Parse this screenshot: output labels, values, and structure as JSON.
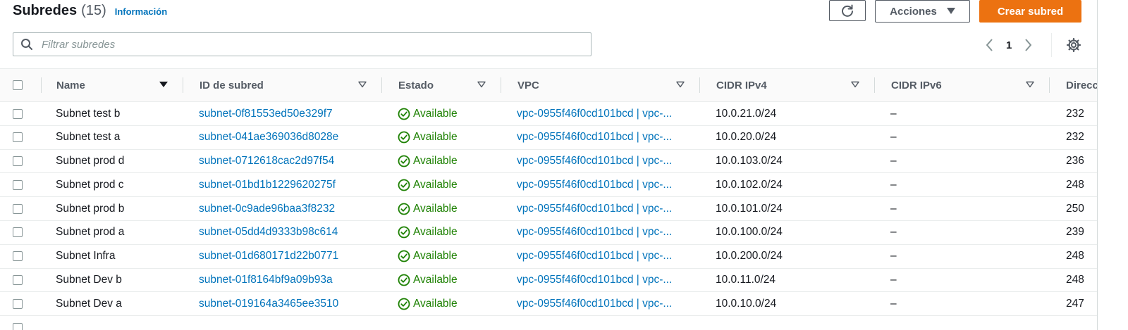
{
  "header": {
    "title": "Subredes",
    "count": "(15)",
    "info_link": "Información"
  },
  "toolbar": {
    "actions_label": "Acciones",
    "create_label": "Crear subred"
  },
  "search": {
    "placeholder": "Filtrar subredes",
    "value": ""
  },
  "pagination": {
    "current_page": "1"
  },
  "table": {
    "columns": {
      "name": "Name",
      "subnet_id": "ID de subred",
      "state": "Estado",
      "vpc": "VPC",
      "cidr_ipv4": "CIDR IPv4",
      "cidr_ipv6": "CIDR IPv6",
      "addresses": "Direcc"
    },
    "rows": [
      {
        "name": "Subnet test b",
        "subnet_id": "subnet-0f81553ed50e329f7",
        "state": "Available",
        "vpc": "vpc-0955f46f0cd101bcd | vpc-...",
        "cidr_ipv4": "10.0.21.0/24",
        "cidr_ipv6": "–",
        "addresses": "232"
      },
      {
        "name": "Subnet test a",
        "subnet_id": "subnet-041ae369036d8028e",
        "state": "Available",
        "vpc": "vpc-0955f46f0cd101bcd | vpc-...",
        "cidr_ipv4": "10.0.20.0/24",
        "cidr_ipv6": "–",
        "addresses": "232"
      },
      {
        "name": "Subnet prod d",
        "subnet_id": "subnet-0712618cac2d97f54",
        "state": "Available",
        "vpc": "vpc-0955f46f0cd101bcd | vpc-...",
        "cidr_ipv4": "10.0.103.0/24",
        "cidr_ipv6": "–",
        "addresses": "236"
      },
      {
        "name": "Subnet prod c",
        "subnet_id": "subnet-01bd1b1229620275f",
        "state": "Available",
        "vpc": "vpc-0955f46f0cd101bcd | vpc-...",
        "cidr_ipv4": "10.0.102.0/24",
        "cidr_ipv6": "–",
        "addresses": "248"
      },
      {
        "name": "Subnet prod b",
        "subnet_id": "subnet-0c9ade96baa3f8232",
        "state": "Available",
        "vpc": "vpc-0955f46f0cd101bcd | vpc-...",
        "cidr_ipv4": "10.0.101.0/24",
        "cidr_ipv6": "–",
        "addresses": "250"
      },
      {
        "name": "Subnet prod a",
        "subnet_id": "subnet-05dd4d9333b98c614",
        "state": "Available",
        "vpc": "vpc-0955f46f0cd101bcd | vpc-...",
        "cidr_ipv4": "10.0.100.0/24",
        "cidr_ipv6": "–",
        "addresses": "239"
      },
      {
        "name": "Subnet Infra",
        "subnet_id": "subnet-01d680171d22b0771",
        "state": "Available",
        "vpc": "vpc-0955f46f0cd101bcd | vpc-...",
        "cidr_ipv4": "10.0.200.0/24",
        "cidr_ipv6": "–",
        "addresses": "248"
      },
      {
        "name": "Subnet Dev b",
        "subnet_id": "subnet-01f8164bf9a09b93a",
        "state": "Available",
        "vpc": "vpc-0955f46f0cd101bcd | vpc-...",
        "cidr_ipv4": "10.0.11.0/24",
        "cidr_ipv6": "–",
        "addresses": "248"
      },
      {
        "name": "Subnet Dev a",
        "subnet_id": "subnet-019164a3465ee3510",
        "state": "Available",
        "vpc": "vpc-0955f46f0cd101bcd | vpc-...",
        "cidr_ipv4": "10.0.10.0/24",
        "cidr_ipv6": "–",
        "addresses": "247"
      },
      {
        "name": "",
        "subnet_id": "",
        "state": "",
        "vpc": "",
        "cidr_ipv4": "",
        "cidr_ipv6": "",
        "addresses": ""
      }
    ]
  },
  "colors": {
    "link": "#0073bb",
    "primary_button": "#ec7211",
    "status_available": "#1d8102"
  }
}
